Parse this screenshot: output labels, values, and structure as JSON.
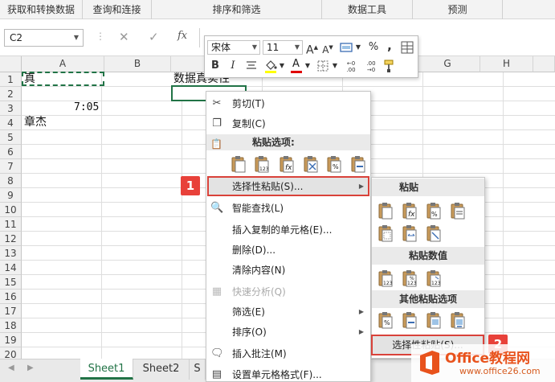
{
  "ribbon_groups": [
    "获取和转换数据",
    "查询和连接",
    "排序和筛选",
    "数据工具",
    "预测"
  ],
  "name_box": "C2",
  "formula_icons": {
    "cancel": "✕",
    "enter": "✓",
    "fx": "fx"
  },
  "columns": [
    "A",
    "B",
    "C",
    "D",
    "E",
    "F",
    "G",
    "H"
  ],
  "rows": [
    "1",
    "2",
    "3",
    "4",
    "5",
    "6",
    "7",
    "8",
    "9",
    "10",
    "11",
    "12",
    "13",
    "14",
    "15",
    "16",
    "17",
    "18",
    "19",
    "20"
  ],
  "cells": {
    "a1": "真",
    "a3": "7:05",
    "a4": "章杰",
    "c1": "数据真实性"
  },
  "sheet_tabs": [
    "Sheet1",
    "Sheet2",
    "S"
  ],
  "mini_toolbar": {
    "font": "宋体",
    "size": "11",
    "bold": "B",
    "italic": "I",
    "grow": "A",
    "shrink": "A",
    "percent": "%",
    "comma": ",",
    "font_color_letter": "A",
    "inc_dec": "←0 .00",
    "dec_dec": ".00 →0"
  },
  "context_menu": {
    "cut": "剪切(T)",
    "copy": "复制(C)",
    "paste_options": "粘贴选项:",
    "paste_special": "选择性粘贴(S)...",
    "smart_lookup": "智能查找(L)",
    "insert_copied": "插入复制的单元格(E)...",
    "delete": "删除(D)...",
    "clear": "清除内容(N)",
    "quick_analysis": "快速分析(Q)",
    "filter": "筛选(E)",
    "sort": "排序(O)",
    "insert_comment": "插入批注(M)",
    "format_cells": "设置单元格格式(F)..."
  },
  "submenu": {
    "paste": "粘贴",
    "paste_values": "粘贴数值",
    "other_paste": "其他粘贴选项",
    "paste_special": "选择性粘贴(S)..."
  },
  "badges": [
    "1",
    "2"
  ],
  "watermark": {
    "brand": "Office教程网",
    "url": "www.office26.com"
  },
  "colors": {
    "excel_green": "#217346",
    "badge_red": "#e8413a",
    "office_orange": "#e8521c"
  }
}
